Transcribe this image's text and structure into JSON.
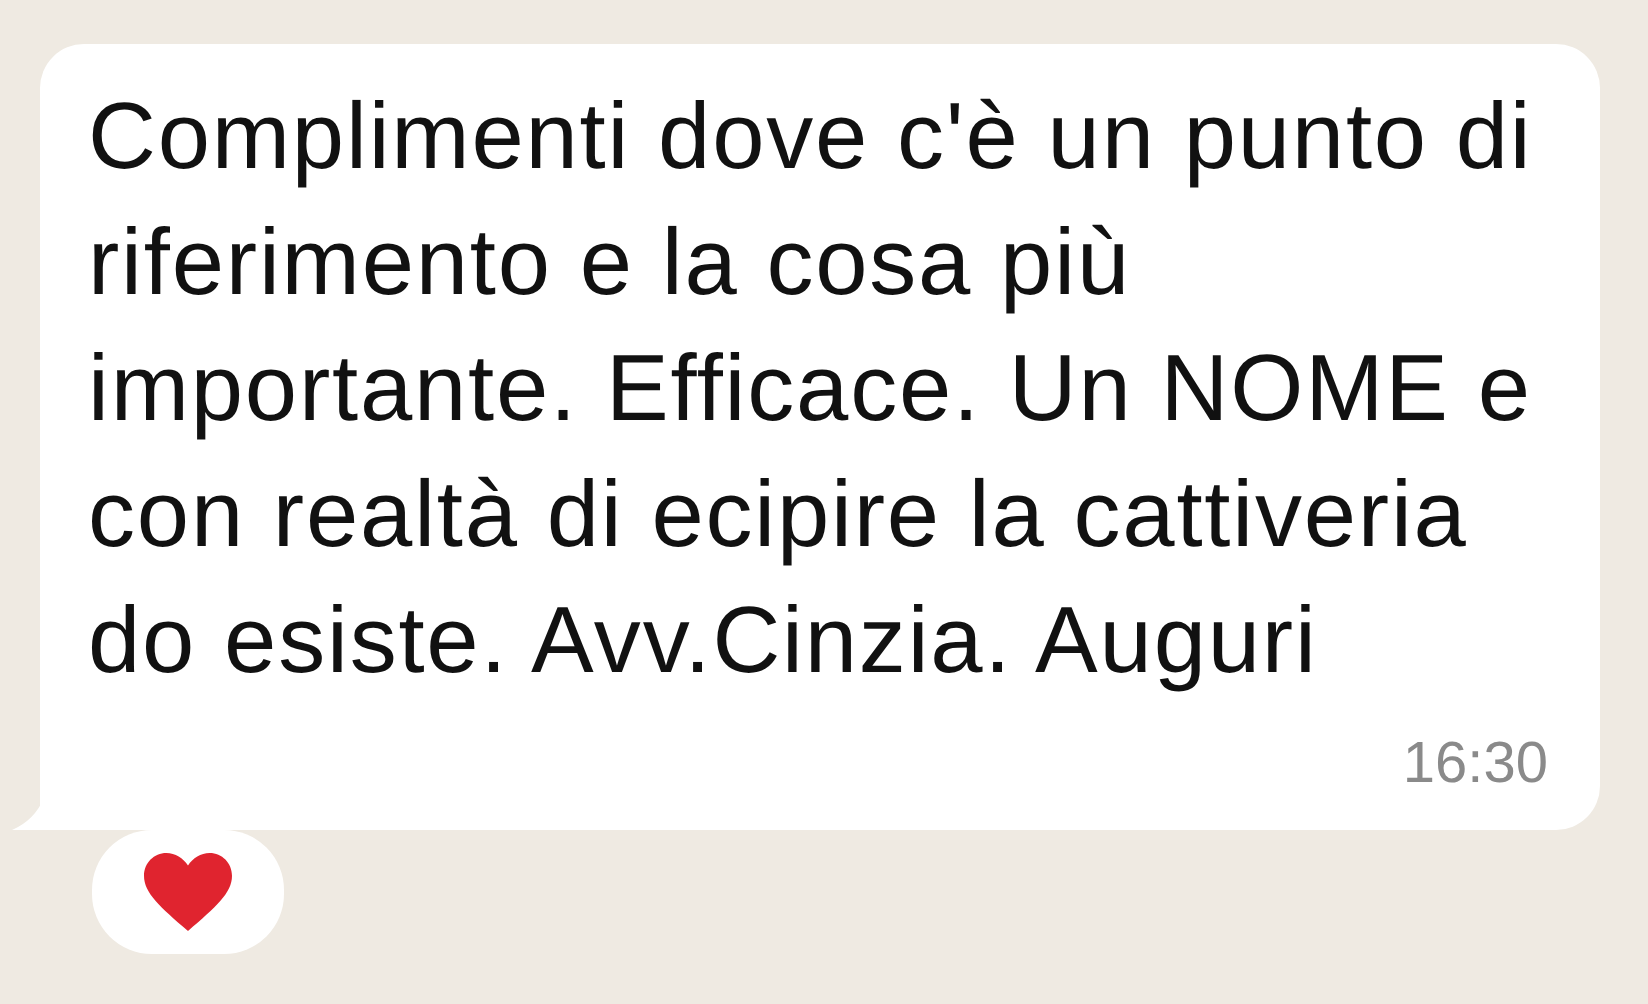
{
  "message": {
    "text_lines": [
      "Complimenti dove c'è un punto di",
      "riferimento e la cosa più",
      "importante. Efficace. Un NOME e",
      "con realtà di ecipire la cattiveria",
      "do esiste. Avv.Cinzia. Auguri"
    ],
    "time": "16:30",
    "reaction": {
      "kind": "heart"
    }
  }
}
